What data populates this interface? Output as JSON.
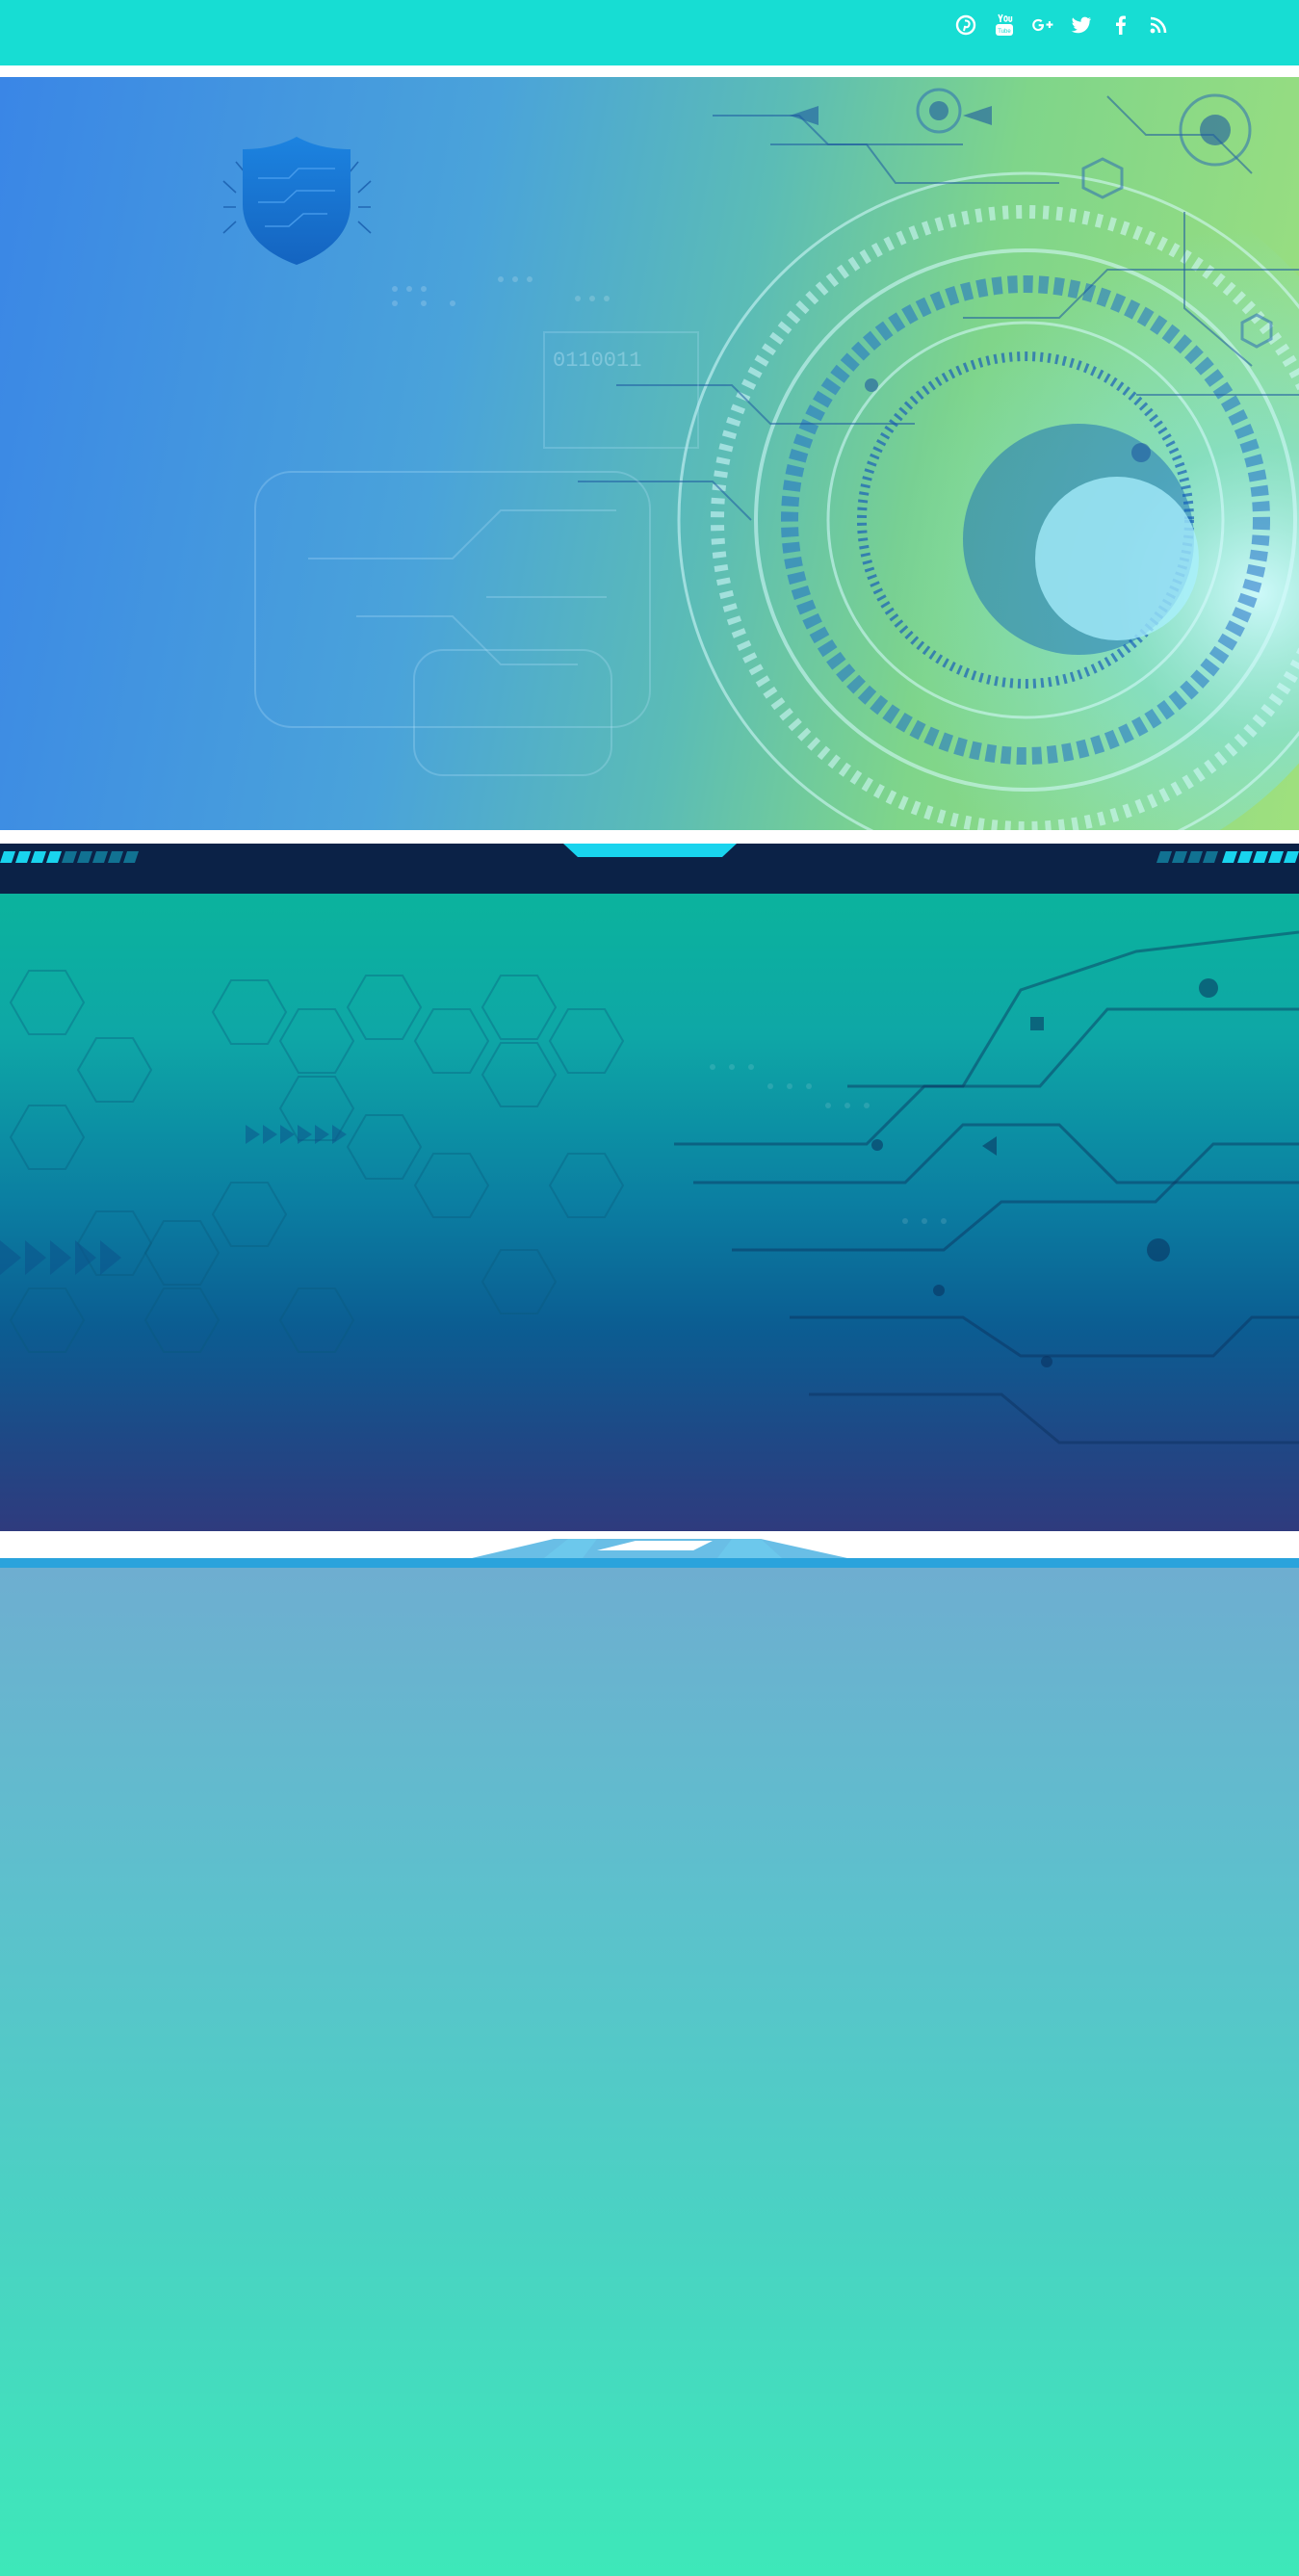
{
  "colors": {
    "topbar": "#17ddd3",
    "hero1_start": "#3a86e6",
    "hero1_end": "#9fe07e",
    "band": "#0b2247",
    "band_accent": "#19d4ee",
    "hero2_top": "#0bb39d",
    "hero2_bottom": "#2f3b7e",
    "panel_top": "#6eaed0",
    "panel_bottom": "#3de8b9"
  },
  "social": {
    "items": [
      {
        "icon": "pinterest-icon"
      },
      {
        "icon": "youtube-icon"
      },
      {
        "icon": "google-plus-icon"
      },
      {
        "icon": "twitter-icon"
      },
      {
        "icon": "facebook-icon"
      },
      {
        "icon": "rss-icon"
      }
    ]
  },
  "hero1": {
    "logo_icon": "shield-circuit-icon",
    "binary_text": "0110011"
  }
}
